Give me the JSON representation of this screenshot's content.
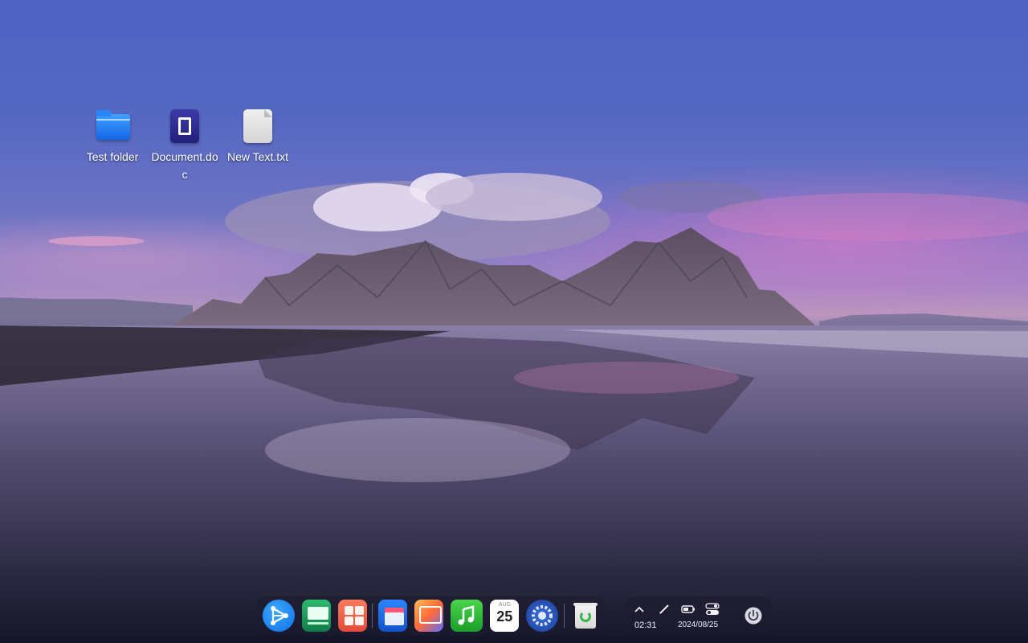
{
  "desktop": {
    "icons": [
      {
        "label": "Test folder",
        "icon": "folder-icon"
      },
      {
        "label": "Document.doc",
        "icon": "office-document-icon"
      },
      {
        "label": "New Text.txt",
        "icon": "text-file-icon"
      }
    ]
  },
  "dock": {
    "apps": [
      {
        "name": "launcher",
        "icon": "launcher-icon"
      },
      {
        "name": "multitask",
        "icon": "multitask-icon"
      },
      {
        "name": "app-store",
        "icon": "app-store-icon"
      },
      {
        "name": "file-manager",
        "icon": "file-manager-icon"
      },
      {
        "name": "image-viewer",
        "icon": "image-viewer-icon"
      },
      {
        "name": "music",
        "icon": "music-icon"
      },
      {
        "name": "calendar",
        "icon": "calendar-icon",
        "month": "AUG",
        "day": "25"
      },
      {
        "name": "control-center",
        "icon": "control-center-icon"
      },
      {
        "name": "trash",
        "icon": "trash-icon"
      }
    ]
  },
  "tray": {
    "time": "02:31",
    "date": "2024/08/25",
    "icons": [
      "expand-arrow-icon",
      "pen-icon",
      "battery-icon",
      "toggle-switches-icon",
      "power-icon"
    ]
  },
  "colors": {
    "accent": "#1e90ff",
    "dock_bg": "#1e1c30"
  }
}
